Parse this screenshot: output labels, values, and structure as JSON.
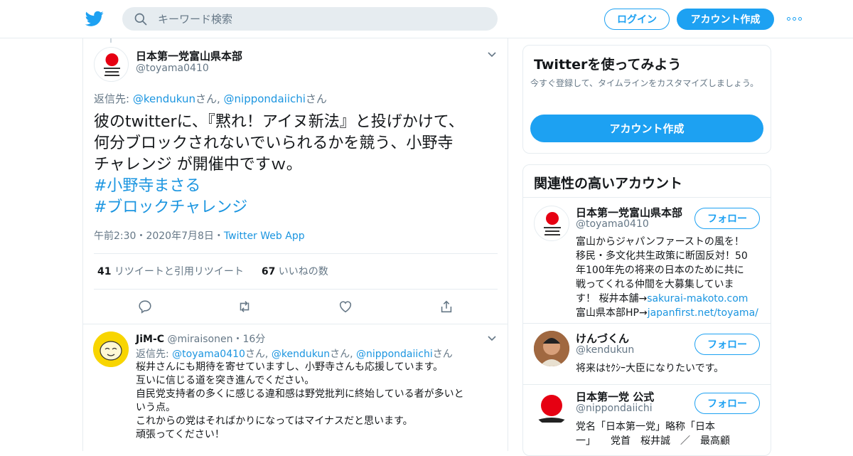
{
  "topbar": {
    "search_placeholder": "キーワード検索",
    "login_label": "ログイン",
    "signup_label": "アカウント作成"
  },
  "tweet": {
    "author_name": "日本第一党富山県本部",
    "author_handle": "@toyama0410",
    "reply_label": "返信先: ",
    "reply_user1": "@kendukun",
    "reply_san1": "さん, ",
    "reply_user2": "@nippondaiichi",
    "reply_san2": "さん",
    "text_lines": [
      "彼のtwitterに、『黙れ！アイヌ新法』と投げかけて、",
      "何分ブロックされないでいられるかを競う、小野寺",
      "チャレンジ が開催中ですｗ。"
    ],
    "hashtags": [
      "#小野寺まさる",
      "#ブロックチャレンジ"
    ],
    "time": "午前2:30・2020年7月8日・",
    "source": "Twitter Web App",
    "retweets_count": "41",
    "retweets_label": " リツイートと引用リツイート",
    "likes_count": "67",
    "likes_label": " いいねの数"
  },
  "reply": {
    "name": "JiM-C",
    "handle": "@miraisonen",
    "time": "・16分",
    "reply_label": "返信先: ",
    "reply_user1": "@toyama0410",
    "reply_user2": "@kendukun",
    "reply_user3": "@nippondaiichi",
    "san_sep": "さん, ",
    "san_end": "さん",
    "lines": [
      "桜井さんにも期待を寄せていますし、小野寺さんも応援しています。",
      "互いに信じる道を突き進んでください。",
      "自民党支持者の多くに感じる違和感は野党批判に終始している者が多いと",
      "いう点。",
      "これからの党はそればかりになってはマイナスだと思います。",
      "頑張ってください！"
    ]
  },
  "sidebar": {
    "signup_card": {
      "title": "Twitterを使ってみよう",
      "subtitle": "今すぐ登録して、タイムラインをカスタマイズしましょう。",
      "button": "アカウント作成"
    },
    "related": {
      "title": "関連性の高いアカウント",
      "follow_label": "フォロー",
      "accounts": [
        {
          "name": "日本第一党富山県本部",
          "handle": "@toyama0410",
          "bio_lines": [
            "富山からジャパンファーストの風を！",
            "移民・多文化共生政策に断固反対！50",
            "年100年先の将来の日本のために共に",
            "戦ってくれる仲間を大募集していま"
          ],
          "bio_line5_text": "す！ 桜井本舗→",
          "bio_line5_link": "sakurai-makoto.com",
          "bio_line6_text": "富山県本部HP→",
          "bio_line6_link": "japanfirst.net/toyama/"
        },
        {
          "name": "けんづくん",
          "handle": "@kendukun",
          "bio_lines": [
            "将来はｾｸｼｰ大臣になりたいです。"
          ]
        },
        {
          "name": "日本第一党 公式",
          "handle": "@nippondaiichi",
          "bio_lines": [
            "党名「日本第一党」略称「日本",
            "一」　　党首　桜井誠　／　最高顧"
          ]
        }
      ]
    }
  },
  "colors": {
    "accent": "#1da1f2",
    "link": "#1b95e0",
    "muted": "#657786",
    "border": "#e6ecf0"
  }
}
